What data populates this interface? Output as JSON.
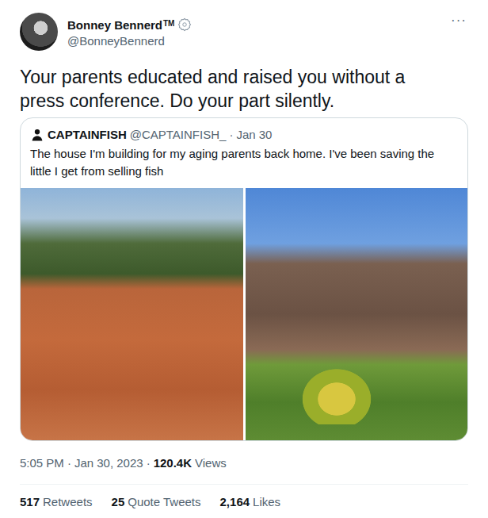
{
  "tweet": {
    "author": {
      "name": "Bonney Bennerd",
      "suffix": "TM",
      "handle": "@BonneyBennerd"
    },
    "more": "···",
    "text": "Your parents educated and raised you without a press conference. Do your part silently.",
    "quoted": {
      "author": {
        "name": "CAPTAINFISH",
        "handle": "@CAPTAINFISH_"
      },
      "separator": "·",
      "date": "Jan 30",
      "text": "The house I'm building for my aging parents back home. I've been saving the little I get from selling fish"
    },
    "meta": {
      "time": "5:05 PM",
      "separator": "·",
      "date": "Jan 30, 2023",
      "views": "120.4K",
      "views_label": "Views"
    },
    "stats": [
      {
        "count": "517",
        "label": "Retweets"
      },
      {
        "count": "25",
        "label": "Quote Tweets"
      },
      {
        "count": "2,164",
        "label": "Likes"
      }
    ]
  }
}
